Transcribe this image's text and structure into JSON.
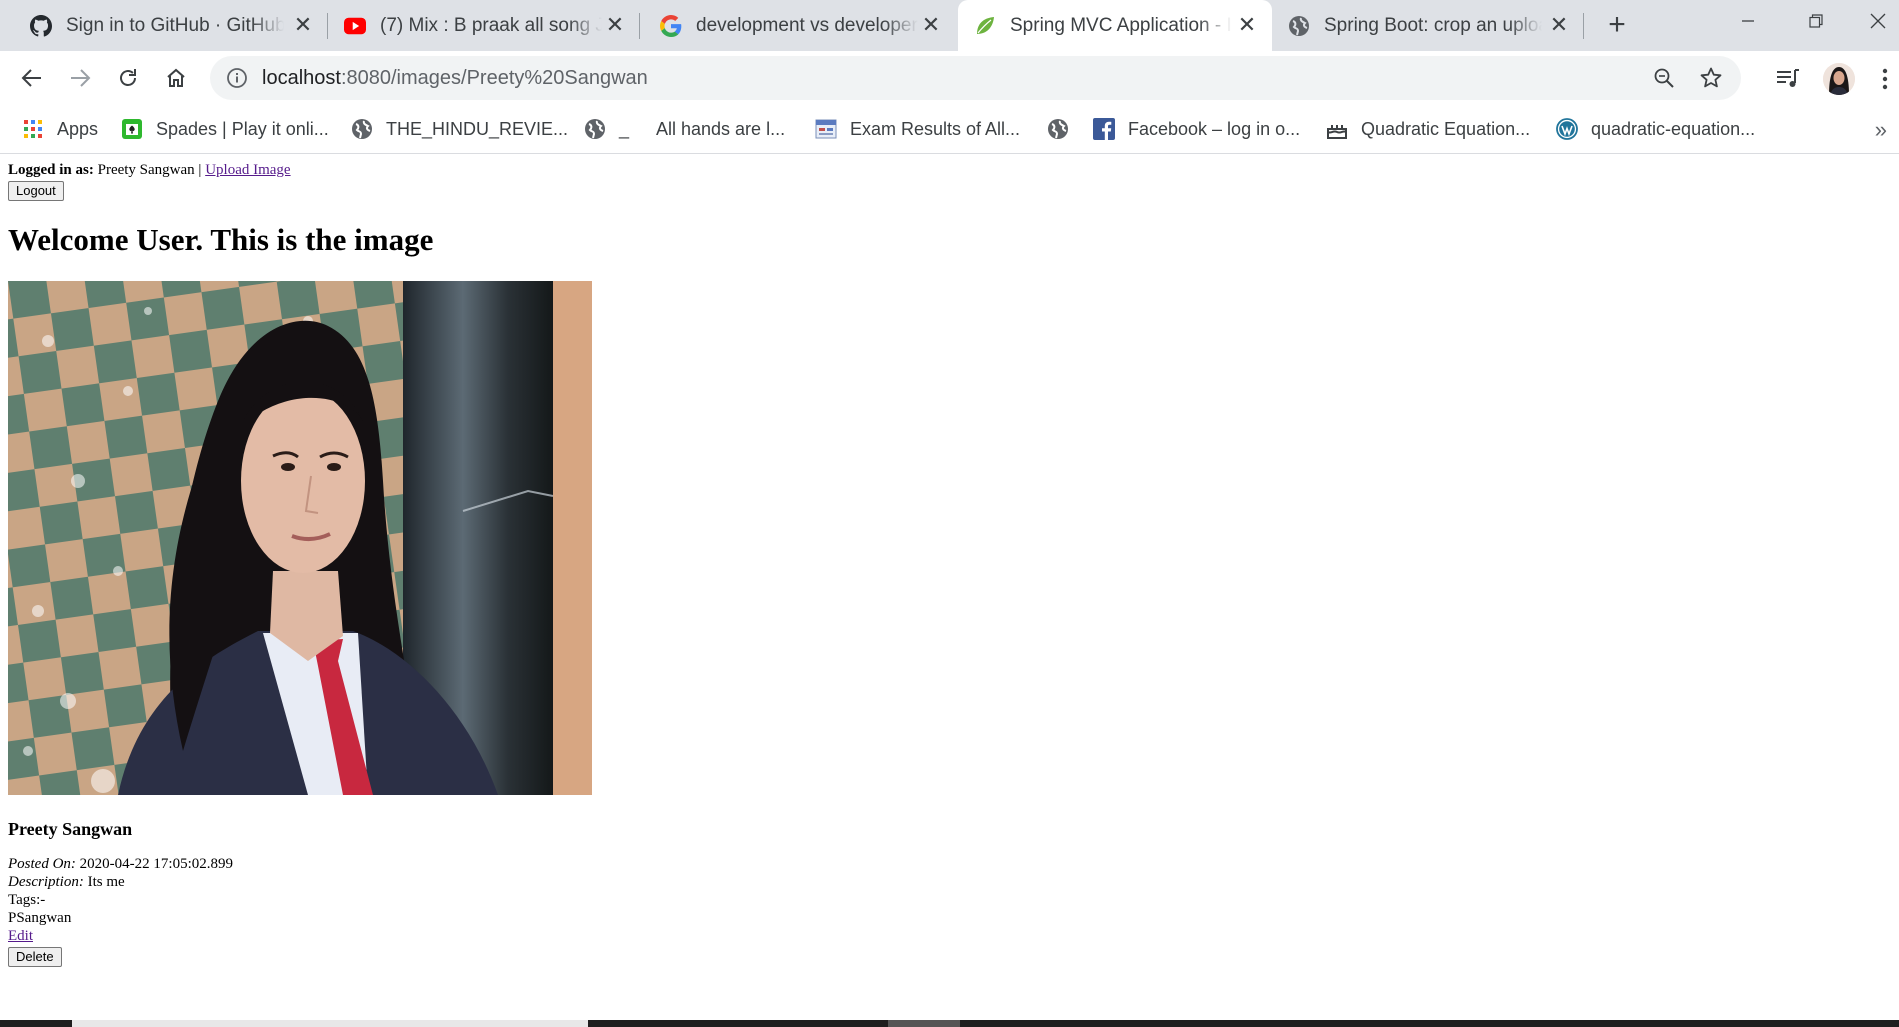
{
  "browser": {
    "tabs": [
      {
        "title": "Sign in to GitHub · GitHub",
        "icon": "github-icon"
      },
      {
        "title": "(7) Mix : B praak all song Jukebox",
        "icon": "youtube-icon"
      },
      {
        "title": "development vs developer job",
        "icon": "google-icon"
      },
      {
        "title": "Spring MVC Application - Image",
        "icon": "spring-icon",
        "active": true
      },
      {
        "title": "Spring Boot: crop an uploaded image",
        "icon": "globe-icon"
      }
    ],
    "new_tab_label": "+",
    "close_glyph": "✕",
    "address": {
      "host": "localhost",
      "path": ":8080/images/Preety%20Sangwan"
    },
    "bookmarks": [
      {
        "label": "Apps",
        "icon": "apps-grid-icon"
      },
      {
        "label": "Spades | Play it onli...",
        "icon": "spades-icon"
      },
      {
        "label": "THE_HINDU_REVIE...",
        "icon": "globe-icon"
      },
      {
        "label": "_",
        "icon": "globe-icon"
      },
      {
        "label": "All hands are l...",
        "icon": ""
      },
      {
        "label": "Exam Results of All...",
        "icon": "exam-results-icon"
      },
      {
        "label": "",
        "icon": "globe-icon"
      },
      {
        "label": "Facebook – log in o...",
        "icon": "facebook-icon"
      },
      {
        "label": "Quadratic Equation...",
        "icon": "cake-icon"
      },
      {
        "label": "quadratic-equation...",
        "icon": "wordpress-icon"
      }
    ],
    "bookmarks_overflow": "»"
  },
  "page": {
    "logged_in_label": "Logged in as:",
    "username": "Preety Sangwan",
    "separator": "|",
    "upload_link": "Upload Image",
    "logout_button": "Logout",
    "heading": "Welcome User. This is the image",
    "image_title": "Preety Sangwan",
    "posted_label": "Posted On:",
    "posted_value": "2020-04-22 17:05:02.899",
    "description_label": "Description:",
    "description_value": "Its me",
    "tags_label": "Tags:-",
    "tag_value": "PSangwan",
    "edit_link": "Edit",
    "delete_button": "Delete"
  }
}
